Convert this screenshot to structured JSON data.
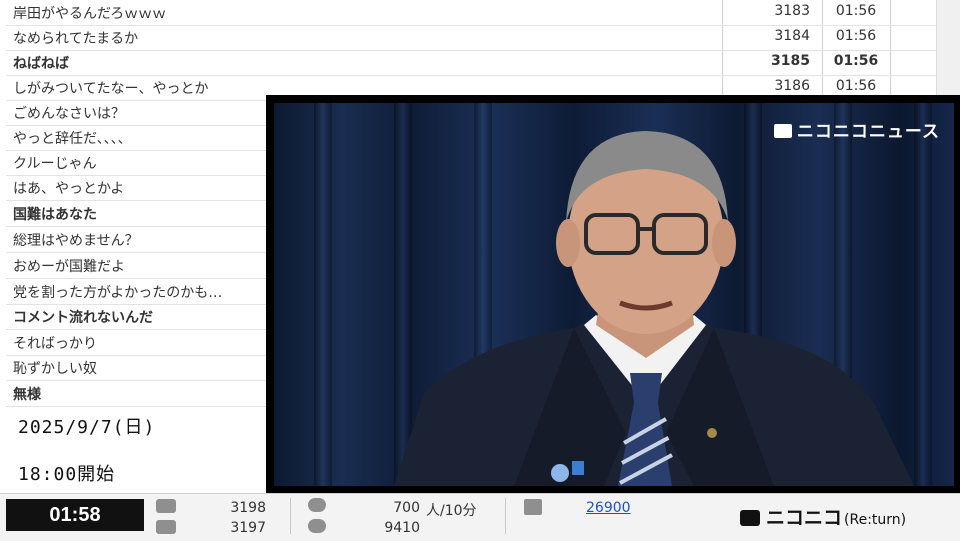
{
  "comments": [
    {
      "text": "岸田がやるんだろｗｗｗ",
      "no": "3183",
      "time": "01:56",
      "bold": false
    },
    {
      "text": "なめられてたまるか",
      "no": "3184",
      "time": "01:56",
      "bold": false
    },
    {
      "text": "ねばねば",
      "no": "3185",
      "time": "01:56",
      "bold": true
    },
    {
      "text": "しがみついてたなー、やっとか",
      "no": "3186",
      "time": "01:56",
      "bold": false
    },
    {
      "text": "ごめんなさいは？",
      "no": "",
      "time": "",
      "bold": false
    },
    {
      "text": "やっと辞任だ、、、、",
      "no": "",
      "time": "",
      "bold": false
    },
    {
      "text": "クルーじゃん",
      "no": "",
      "time": "",
      "bold": false
    },
    {
      "text": "はあ、やっとかよ",
      "no": "",
      "time": "",
      "bold": false
    },
    {
      "text": "国難はあなた",
      "no": "",
      "time": "",
      "bold": true
    },
    {
      "text": "総理はやめません？",
      "no": "",
      "time": "",
      "bold": false
    },
    {
      "text": "おめーが国難だよ",
      "no": "",
      "time": "",
      "bold": false
    },
    {
      "text": "党を割った方がよかったのかも…",
      "no": "",
      "time": "",
      "bold": false
    },
    {
      "text": "コメント流れないんだ",
      "no": "",
      "time": "",
      "bold": true
    },
    {
      "text": "そればっかり",
      "no": "",
      "time": "",
      "bold": false
    },
    {
      "text": "恥ずかしい奴",
      "no": "",
      "time": "",
      "bold": false
    },
    {
      "text": "無様",
      "no": "",
      "time": "",
      "bold": true
    }
  ],
  "overlay": {
    "date": "2025/9/7(日)",
    "start": "18:00開始"
  },
  "video": {
    "channel_logo": "ニコニコニュース",
    "colors": {
      "curtain": "#14264a",
      "suit": "#1b2233",
      "shirt": "#f2f2f2",
      "tie": "#2b3f6e"
    }
  },
  "bottom_bar": {
    "elapsed": "01:58",
    "comment_icon": "comment-icon",
    "comments_total": "3198",
    "comments_other": "3197",
    "viewers_icon": "viewers-icon",
    "rate_value": "700",
    "rate_unit": "人/10分",
    "viewers_total": "9410",
    "ad_icon": "megaphone-icon",
    "points": "26900",
    "logo": "ニコニコ",
    "logo_sub": "(Re:turn)"
  }
}
